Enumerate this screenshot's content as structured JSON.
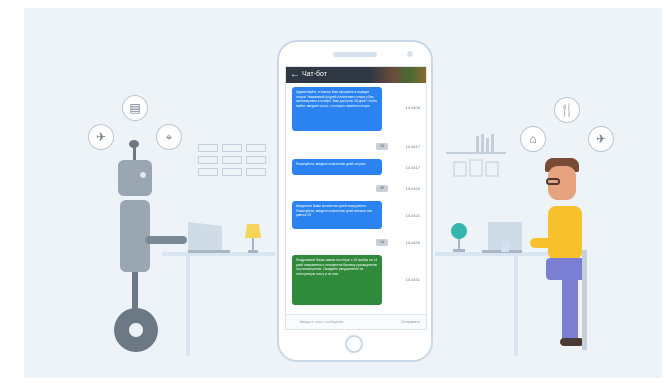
{
  "colors": {
    "background": "#eef3f7",
    "app_bar": "#2f3742",
    "bot_bubble": "#2a83f0",
    "final_bubble": "#2f8a3b",
    "user_bubble": "#c9cfd6",
    "accent_shirt": "#f6c12c",
    "accent_pants": "#7a7fd4"
  },
  "chat": {
    "title": "Чат-бот",
    "back_icon": "←",
    "messages": [
      {
        "type": "bot",
        "text": "Здравствуйте, я помогу Вам оформить в порядке отпуск! Уважаемый Андрей Алексеевич отпуск у Вас запланирован в ноябре. Вам доступно 28 дней. Чтобы выйти, введите число, с которого начнётся отпуск.",
        "time": "10:4406"
      },
      {
        "type": "user",
        "text": "15",
        "time": "10:4417"
      },
      {
        "type": "bot",
        "text": "Пожалуйста, введите количество дней отпуска",
        "time": "10:4417"
      },
      {
        "type": "user",
        "text": "30",
        "time": "10:4420"
      },
      {
        "type": "bot",
        "text": "Введенное Вами количество дней некорректно. Пожалуйста, введите количество дней меньше или равное 28",
        "time": "10:4421"
      },
      {
        "type": "user",
        "text": "14",
        "time": "10:4429"
      },
      {
        "type": "bot_final",
        "text": "Поздравляю! Ваша заявка на отпуск с 15 ноября на 14 дней направлена и отправлена Вашему руководителю на рассмотрение. Ожидайте уведомление на электронную почту и по sms.",
        "time": "10:4431"
      }
    ],
    "input_placeholder": "Введите текст сообщения",
    "send_label": "Отправить"
  },
  "icons": {
    "robot_bubbles": [
      "plane-icon",
      "document-icon",
      "location-icon"
    ],
    "human_bubbles": [
      "bank-icon",
      "restaurant-icon",
      "airplane-icon"
    ]
  }
}
